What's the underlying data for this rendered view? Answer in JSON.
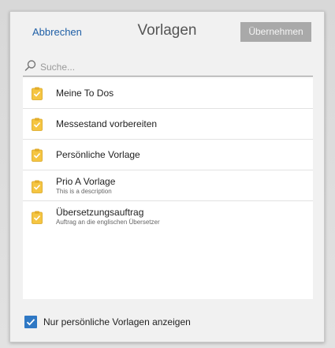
{
  "header": {
    "cancel_label": "Abbrechen",
    "title": "Vorlagen",
    "apply_label": "Übernehmen"
  },
  "search": {
    "placeholder": "Suche...",
    "value": ""
  },
  "templates": [
    {
      "title": "Meine To Dos",
      "description": "",
      "icon": "clipboard-icon"
    },
    {
      "title": "Messestand vorbereiten",
      "description": "",
      "icon": "clipboard-icon"
    },
    {
      "title": "Persönliche Vorlage",
      "description": "",
      "icon": "clipboard-icon"
    },
    {
      "title": "Prio A Vorlage",
      "description": "This is a description",
      "icon": "clipboard-icon"
    },
    {
      "title": "Übersetzungsauftrag",
      "description": "Auftrag an die englischen Übersetzer",
      "icon": "clipboard-icon"
    }
  ],
  "footer": {
    "checkbox_label": "Nur persönliche Vorlagen anzeigen",
    "checkbox_checked": true
  },
  "colors": {
    "accent": "#2f78c4",
    "link": "#1f5fa6",
    "apply_button_bg": "#a9a9a9",
    "icon_fill": "#f5c542"
  }
}
